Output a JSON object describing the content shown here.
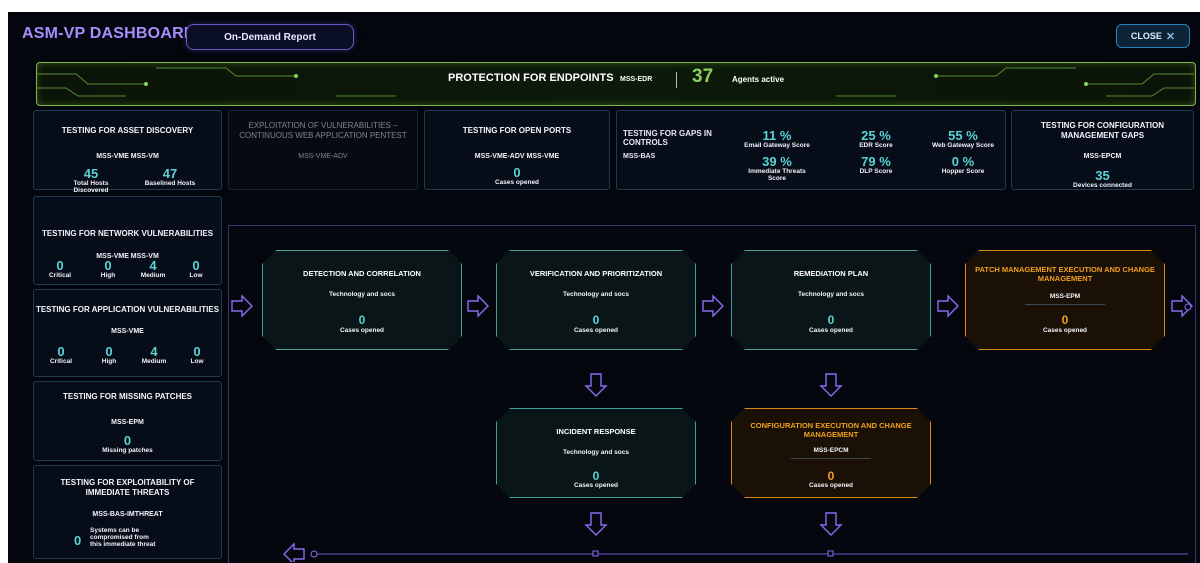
{
  "header": {
    "title": "ASM-VP DASHBOARD",
    "report_button": "On-Demand Report",
    "close_button": "CLOSE",
    "close_glyph": "✕"
  },
  "banner": {
    "title": "PROTECTION FOR ENDPOINTS",
    "code": "MSS-EDR",
    "count": "37",
    "count_label": "Agents active"
  },
  "top_cards": {
    "asset_discovery": {
      "title": "TESTING FOR ASSET DISCOVERY",
      "codes": "MSS-VME   MSS-VM",
      "stats": [
        {
          "value": "45",
          "label": "Total Hosts Discovered"
        },
        {
          "value": "47",
          "label": "Baselined Hosts"
        }
      ]
    },
    "web_pentest": {
      "title": "EXPLOITATION OF VULNERABILITIES – CONTINUOUS WEB APPLICATION PENTEST",
      "codes": "MSS-VME-ADV"
    },
    "open_ports": {
      "title": "TESTING FOR OPEN PORTS",
      "codes": "MSS-VME-ADV   MSS-VME",
      "value": "0",
      "label": "Cases opened"
    },
    "gaps_in_controls": {
      "title": "TESTING FOR GAPS IN CONTROLS",
      "code": "MSS-BAS",
      "scores": [
        {
          "value": "11 %",
          "label": "Email Gateway Score"
        },
        {
          "value": "25 %",
          "label": "EDR Score"
        },
        {
          "value": "55 %",
          "label": "Web Gateway Score"
        },
        {
          "value": "39 %",
          "label": "Immediate Threats Score"
        },
        {
          "value": "79 %",
          "label": "DLP Score"
        },
        {
          "value": "0 %",
          "label": "Hopper Score"
        }
      ]
    },
    "config_gaps": {
      "title": "TESTING FOR CONFIGURATION MANAGEMENT GAPS",
      "code": "MSS-EPCM",
      "value": "35",
      "label": "Devices connected"
    }
  },
  "left_cards": {
    "network_vuln": {
      "title": "TESTING FOR NETWORK VULNERABILITIES",
      "codes": "MSS-VME   MSS-VM",
      "stats": [
        {
          "value": "0",
          "label": "Critical"
        },
        {
          "value": "0",
          "label": "High"
        },
        {
          "value": "4",
          "label": "Medium"
        },
        {
          "value": "0",
          "label": "Low"
        }
      ]
    },
    "app_vuln": {
      "title": "TESTING FOR APPLICATION VULNERABILITIES",
      "codes": "MSS-VME",
      "stats": [
        {
          "value": "0",
          "label": "Critical"
        },
        {
          "value": "0",
          "label": "High"
        },
        {
          "value": "4",
          "label": "Medium"
        },
        {
          "value": "0",
          "label": "Low"
        }
      ]
    },
    "missing_patches": {
      "title": "TESTING FOR MISSING PATCHES",
      "code": "MSS-EPM",
      "value": "0",
      "label": "Missing patches"
    },
    "immediate_threats": {
      "title": "TESTING FOR EXPLOITABILITY OF IMMEDIATE THREATS",
      "code": "MSS-BAS-IMTHREAT",
      "value": "0",
      "label": "Systems can be compromised from this immediate threat"
    }
  },
  "flow": {
    "detection": {
      "title": "DETECTION AND CORRELATION",
      "sub": "Technology and socs",
      "value": "0",
      "label": "Cases opened"
    },
    "verification": {
      "title": "VERIFICATION AND PRIORITIZATION",
      "sub": "Technology and socs",
      "value": "0",
      "label": "Cases opened"
    },
    "remediation": {
      "title": "REMEDIATION PLAN",
      "sub": "Technology and socs",
      "value": "0",
      "label": "Cases opened"
    },
    "patch_mgmt": {
      "title": "PATCH MANAGEMENT EXECUTION AND CHANGE MANAGEMENT",
      "sub": "MSS-EPM",
      "value": "0",
      "label": "Cases opened"
    },
    "incident": {
      "title": "INCIDENT RESPONSE",
      "sub": "Technology and socs",
      "value": "0",
      "label": "Cases opened"
    },
    "config_exec": {
      "title": "CONFIGURATION EXECUTION AND CHANGE MANAGEMENT",
      "sub": "MSS-EPCM",
      "value": "0",
      "label": "Cases opened"
    }
  },
  "colors": {
    "accent_purple": "#a98cff",
    "teal": "#5bd3d5",
    "orange": "#f0a020",
    "banner_green": "#8ad05a"
  }
}
